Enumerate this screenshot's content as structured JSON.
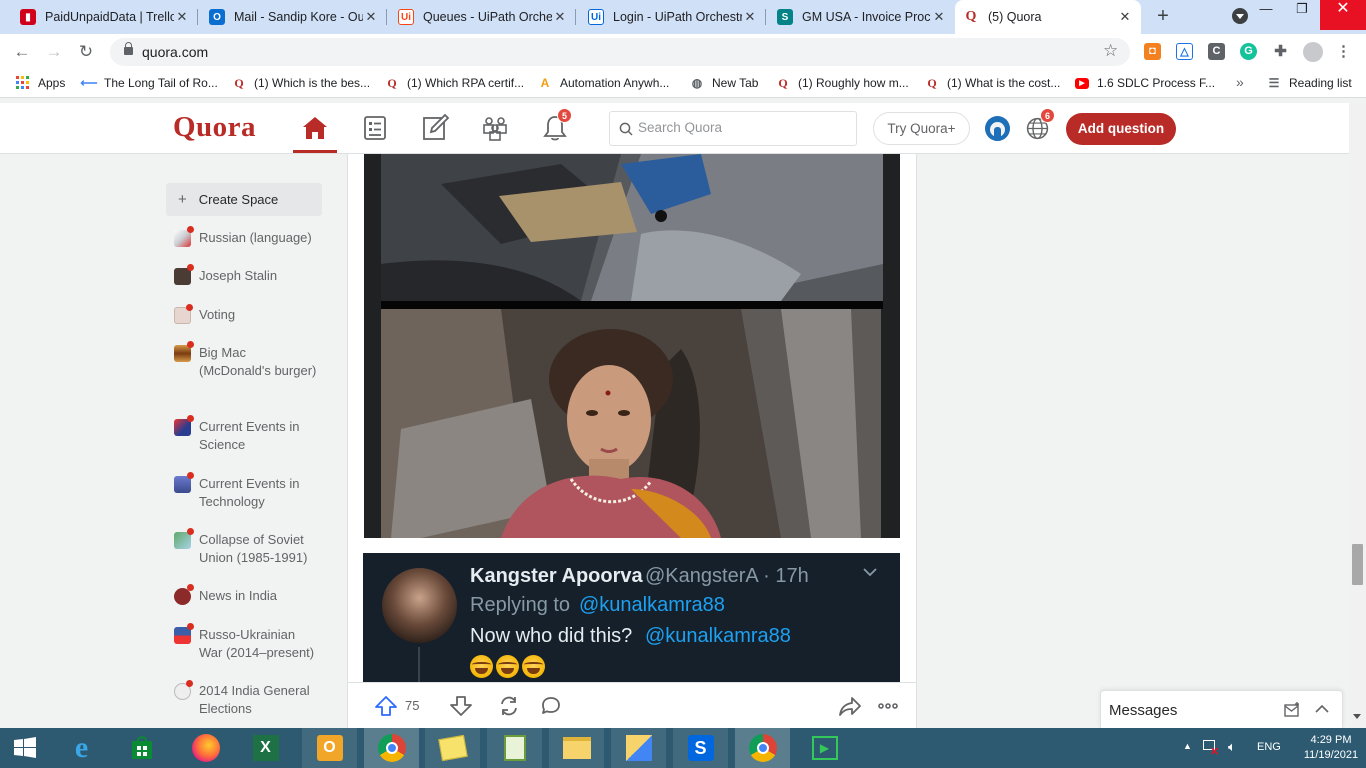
{
  "browser": {
    "tabs": [
      {
        "title": "PaidUnpaidData | Trello",
        "icon": "trello-icon",
        "color": "#d0021b"
      },
      {
        "title": "Mail - Sandip Kore - Ou",
        "icon": "outlook-icon",
        "color": "#0a6ed1"
      },
      {
        "title": "Queues - UiPath Orches",
        "icon": "uipath-icon",
        "color": "#fa4616"
      },
      {
        "title": "Login - UiPath Orchestr",
        "icon": "uipath-blue-icon",
        "color": "#0067df"
      },
      {
        "title": "GM USA - Invoice Proc",
        "icon": "sharepoint-icon",
        "color": "#038387"
      },
      {
        "title": "(5) Quora",
        "icon": "quora-icon",
        "color": "#b92b27",
        "active": true
      }
    ],
    "new_tab_symbol": "+",
    "close_symbol": "✕",
    "url": "quora.com",
    "bookmarks": [
      {
        "label": "Apps",
        "icon": "apps-grid-icon"
      },
      {
        "label": "The Long Tail of Ro...",
        "icon": "longtail-icon"
      },
      {
        "label": "(1) Which is the bes...",
        "icon": "quora-icon"
      },
      {
        "label": "(1) Which RPA certif...",
        "icon": "quora-icon"
      },
      {
        "label": "Automation Anywh...",
        "icon": "automation-anywhere-icon"
      },
      {
        "label": "New Tab",
        "icon": "globe-icon"
      },
      {
        "label": "(1) Roughly how m...",
        "icon": "quora-icon"
      },
      {
        "label": "(1) What is the cost...",
        "icon": "quora-icon"
      },
      {
        "label": "1.6 SDLC Process F...",
        "icon": "youtube-icon"
      }
    ],
    "bookmarks_more": "»",
    "reading_list": "Reading list"
  },
  "quora": {
    "logo": "Quora",
    "notifications_count": "5",
    "language_count": "6",
    "search_placeholder": "Search Quora",
    "try_plus": "Try Quora+",
    "add_question": "Add question",
    "create_space": "Create Space",
    "spaces": [
      {
        "label": "Russian (language)",
        "color": "#c9ccd1"
      },
      {
        "label": "Joseph Stalin",
        "color": "#4a3b34"
      },
      {
        "label": "Voting",
        "color": "#e7d6cf"
      },
      {
        "label": "Big Mac (McDonald's burger)",
        "color": "#c98a3a"
      },
      {
        "label": "Current Events in Science",
        "color": "#2a3c8f"
      },
      {
        "label": "Current Events in Technology",
        "color": "#3b4a8c"
      },
      {
        "label": "Collapse of Soviet Union (1985-1991)",
        "color": "#5fa86a"
      },
      {
        "label": "News in India",
        "color": "#8c2a2a"
      },
      {
        "label": "Russo-Ukrainian War (2014–present)",
        "color": "#3b5ea8"
      },
      {
        "label": "2014 India General Elections",
        "color": "#e0e0e0"
      }
    ],
    "tweet": {
      "name": "Kangster Apoorva",
      "handle": "@KangsterA · 17h",
      "reply_prefix": "Replying to",
      "reply_handle": "@kunalkamra88",
      "body": "Now who did this?",
      "body_link": "@kunalkamra88"
    },
    "upvotes": "75",
    "messages": "Messages"
  },
  "taskbar": {
    "apps": [
      "start",
      "internet-explorer",
      "store",
      "firefox",
      "excel",
      "outlook",
      "chrome",
      "notes",
      "notepad",
      "file-explorer",
      "network-tool",
      "uipath-studio",
      "chrome-profile",
      "media-player"
    ],
    "language": "ENG",
    "time": "4:29 PM",
    "date": "11/19/2021"
  }
}
